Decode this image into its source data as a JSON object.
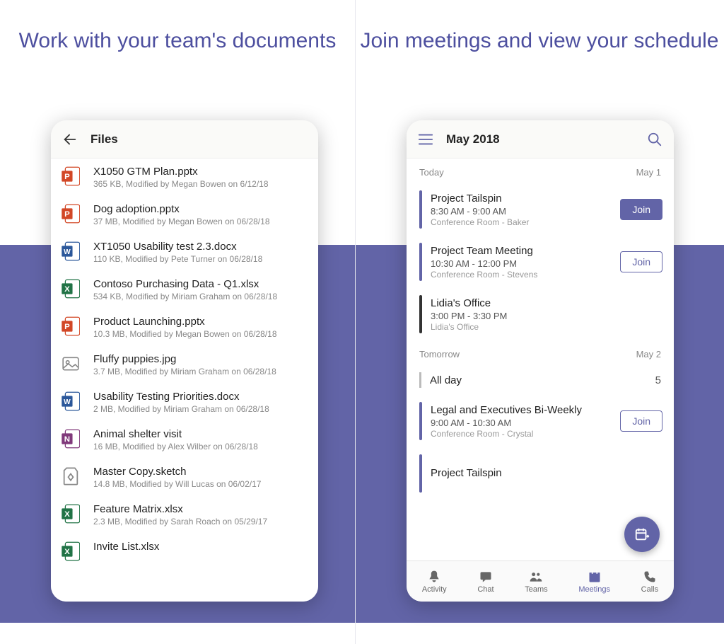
{
  "headlines": {
    "left": "Work with your team's documents",
    "right": "Join meetings and view your schedule"
  },
  "files": {
    "title": "Files",
    "items": [
      {
        "icon": "ppt",
        "name": "X1050 GTM Plan.pptx",
        "meta": "365 KB,  Modified by  Megan Bowen  on 6/12/18"
      },
      {
        "icon": "ppt",
        "name": "Dog adoption.pptx",
        "meta": "37 MB,  Modified by  Megan Bowen  on 06/28/18"
      },
      {
        "icon": "word",
        "name": "XT1050 Usability test 2.3.docx",
        "meta": "110 KB,  Modified by  Pete Turner  on 06/28/18"
      },
      {
        "icon": "excel",
        "name": "Contoso Purchasing Data - Q1.xlsx",
        "meta": "534 KB,  Modified by  Miriam Graham  on 06/28/18"
      },
      {
        "icon": "ppt",
        "name": "Product Launching.pptx",
        "meta": "10.3 MB,  Modified by  Megan Bowen  on 06/28/18"
      },
      {
        "icon": "image",
        "name": "Fluffy puppies.jpg",
        "meta": "3.7 MB,  Modified by  Miriam Graham  on 06/28/18"
      },
      {
        "icon": "word",
        "name": "Usability Testing Priorities.docx",
        "meta": "2 MB,  Modified by  Miriam Graham  on 06/28/18"
      },
      {
        "icon": "onenote",
        "name": "Animal shelter visit",
        "meta": "16 MB,  Modified by  Alex Wilber  on 06/28/18"
      },
      {
        "icon": "sketch",
        "name": "Master Copy.sketch",
        "meta": "14.8 MB,  Modified by  Will Lucas  on 06/02/17"
      },
      {
        "icon": "excel",
        "name": "Feature Matrix.xlsx",
        "meta": "2.3 MB,  Modified by  Sarah Roach  on 05/29/17"
      },
      {
        "icon": "excel",
        "name": "Invite List.xlsx",
        "meta": ""
      }
    ]
  },
  "schedule": {
    "title": "May 2018",
    "days": [
      {
        "label": "Today",
        "date": "May 1",
        "events": [
          {
            "bar": "accent",
            "title": "Project Tailspin",
            "time": "8:30 AM - 9:00 AM",
            "loc": "Conference Room - Baker",
            "join": "solid",
            "join_label": "Join"
          },
          {
            "bar": "accent",
            "title": "Project Team Meeting",
            "time": "10:30 AM - 12:00 PM",
            "loc": "Conference Room - Stevens",
            "join": "outline",
            "join_label": "Join"
          },
          {
            "bar": "dark",
            "title": "Lidia's Office",
            "time": "3:00 PM - 3:30 PM",
            "loc": "Lidia's Office",
            "join": null
          }
        ]
      },
      {
        "label": "Tomorrow",
        "date": "May 2",
        "allday": {
          "label": "All day",
          "count": 5
        },
        "events": [
          {
            "bar": "accent",
            "title": "Legal and Executives Bi-Weekly",
            "time": "9:00 AM - 10:30 AM",
            "loc": "Conference Room - Crystal",
            "join": "outline",
            "join_label": "Join"
          },
          {
            "bar": "accent",
            "title": "Project Tailspin",
            "time": "",
            "loc": "",
            "join": null
          }
        ]
      }
    ]
  },
  "nav": {
    "items": [
      {
        "id": "activity",
        "label": "Activity"
      },
      {
        "id": "chat",
        "label": "Chat"
      },
      {
        "id": "teams",
        "label": "Teams"
      },
      {
        "id": "meetings",
        "label": "Meetings"
      },
      {
        "id": "calls",
        "label": "Calls"
      }
    ],
    "active": "meetings"
  },
  "colors": {
    "accent": "#6264a7",
    "ppt": "#d24726",
    "word": "#2b579a",
    "excel": "#217346",
    "onenote": "#80397b"
  }
}
